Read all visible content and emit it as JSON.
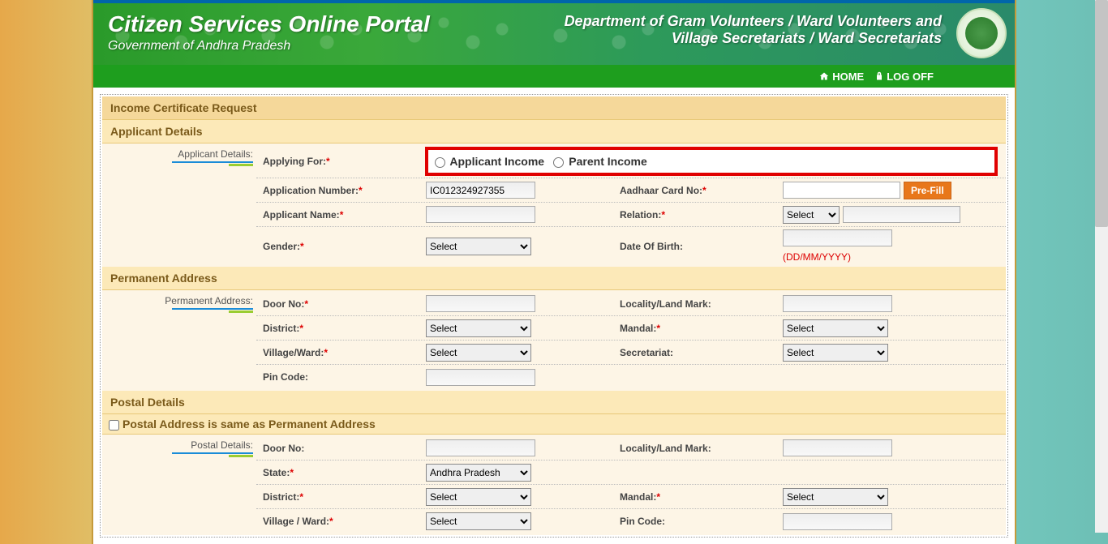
{
  "banner": {
    "title": "Citizen Services Online Portal",
    "subtitle": "Government of Andhra Pradesh",
    "dept1": "Department of Gram Volunteers / Ward Volunteers and",
    "dept2": "Village Secretariats / Ward Secretariats"
  },
  "nav": {
    "home": "HOME",
    "logoff": "LOG OFF"
  },
  "page": {
    "main_heading": "Income Certificate Request"
  },
  "applicant": {
    "section": "Applicant Details",
    "side": "Applicant Details:",
    "applying_for": "Applying For:",
    "opt1": "Applicant Income",
    "opt2": "Parent Income",
    "app_no_label": "Application Number:",
    "app_no_value": "IC012324927355",
    "aadhaar_label": "Aadhaar Card No:",
    "prefill": "Pre-Fill",
    "name_label": "Applicant Name:",
    "relation_label": "Relation:",
    "gender_label": "Gender:",
    "dob_label": "Date Of Birth:",
    "select": "Select",
    "dob_hint": "(DD/MM/YYYY)"
  },
  "perm": {
    "section": "Permanent Address",
    "side": "Permanent Address:",
    "door": "Door No:",
    "locality": "Locality/Land Mark:",
    "district": "District:",
    "mandal": "Mandal:",
    "village": "Village/Ward:",
    "secretariat": "Secretariat:",
    "pin": "Pin Code:",
    "select": "Select"
  },
  "postal": {
    "section": "Postal Details",
    "same": "Postal Address is same as Permanent Address",
    "side": "Postal Details:",
    "door": "Door No:",
    "locality": "Locality/Land Mark:",
    "state": "State:",
    "state_value": "Andhra Pradesh",
    "district": "District:",
    "mandal": "Mandal:",
    "village": "Village / Ward:",
    "pin": "Pin Code:",
    "select": "Select"
  }
}
